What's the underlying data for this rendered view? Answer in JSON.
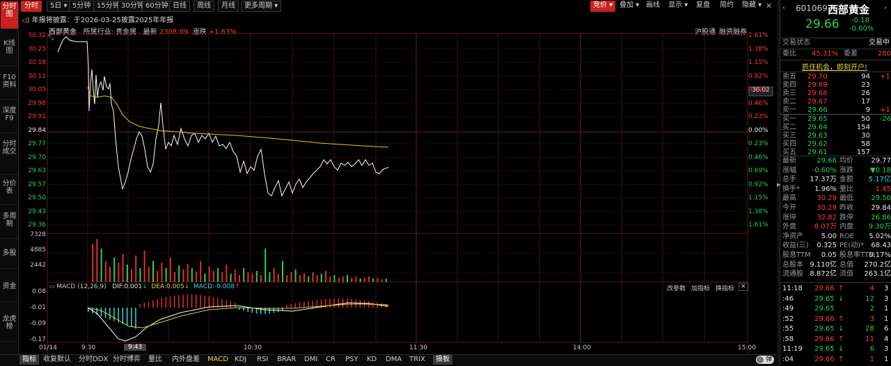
{
  "left_tabs": [
    "分时图",
    "K线图",
    "F10资料",
    "深度F9",
    "分时成交",
    "分价表",
    "多周期",
    "多股",
    "资金",
    "龙虎榜"
  ],
  "toolbar": {
    "periods": [
      "分时",
      "5日",
      "5分钟",
      "15分钟",
      "30分钟",
      "60分钟",
      "日线",
      "周线",
      "月线",
      "更多周期"
    ],
    "right": [
      "竞价",
      "叠加",
      "画线",
      "显示",
      "复盘",
      "简约",
      "隐藏"
    ]
  },
  "announcement": "年报将披露：于2026-03-25披露2025年年报",
  "info_bar": {
    "name": "西部黄金",
    "industry_label": "所属行业:",
    "industry": "贵金属",
    "latest_label": "最新",
    "latest": "2308.09",
    "change_label": "涨跌",
    "change": "+1.63%",
    "right_links": [
      "沪股通",
      "融资融券"
    ]
  },
  "price_axis_left": [
    "30.32",
    "30.25",
    "30.18",
    "30.11",
    "30.05",
    "29.98",
    "29.91",
    "29.84",
    "29.77",
    "29.70",
    "29.63",
    "29.57",
    "29.50",
    "29.43",
    "29.36"
  ],
  "price_axis_right": [
    "1.61%",
    "1.38%",
    "1.15%",
    "0.92%",
    "0.69%",
    "0.46%",
    "0.23%",
    "0.00%",
    "0.23%",
    "0.46%",
    "0.69%",
    "0.92%",
    "1.15%",
    "1.38%",
    "1.61%"
  ],
  "current_price_tag": "30.02",
  "volume_axis": [
    "7328",
    "4885",
    "2442"
  ],
  "macd": {
    "title": "MACD (12,26,9)",
    "dif": "DIF:0.001",
    "dea": "DEA:0.005",
    "macd": "MACD:-0.008",
    "axis": [
      "0.08",
      "-0.01",
      "-0.09",
      "-0.17"
    ],
    "right_links": [
      "改参数",
      "加指标",
      "换指标"
    ]
  },
  "time_axis": [
    "01/14",
    "9:30",
    "9:43",
    "10:30",
    "11:30",
    "14:00",
    "15:00"
  ],
  "bottom_tabs": [
    "指标",
    "收复默认",
    "分时DDX",
    "分时博弈",
    "量比",
    "内外盘差",
    "MACD",
    "KDJ",
    "RSI",
    "BRAR",
    "DMI",
    "CR",
    "PSY",
    "KD",
    "DMA",
    "TRIX",
    "摸板"
  ],
  "bottom_right": "弹",
  "stock": {
    "code": "601069",
    "name": "西部黄金",
    "price": "29.66",
    "change": "-0.18",
    "change_pct": "-0.60%",
    "status_label": "交易状态",
    "status": "交易中",
    "weibi_label": "委比",
    "weibi": "45.31%",
    "weicha_label": "委差",
    "weicha": "280",
    "banner": "抓住机会，即刻开户!"
  },
  "sell_orders": [
    {
      "label": "卖五",
      "price": "29.70",
      "vol": "94",
      "chg": "+1"
    },
    {
      "label": "卖四",
      "price": "29.69",
      "vol": "23",
      "chg": ""
    },
    {
      "label": "卖三",
      "price": "29.68",
      "vol": "26",
      "chg": ""
    },
    {
      "label": "卖二",
      "price": "29.67",
      "vol": "17",
      "chg": ""
    },
    {
      "label": "卖一",
      "price": "29.66",
      "vol": "9",
      "chg": "+1"
    }
  ],
  "buy_orders": [
    {
      "label": "买一",
      "price": "29.65",
      "vol": "50",
      "chg": "-26"
    },
    {
      "label": "买二",
      "price": "29.64",
      "vol": "154",
      "chg": ""
    },
    {
      "label": "买三",
      "price": "29.63",
      "vol": "30",
      "chg": ""
    },
    {
      "label": "买四",
      "price": "29.62",
      "vol": "58",
      "chg": ""
    },
    {
      "label": "买五",
      "price": "29.61",
      "vol": "157",
      "chg": ""
    }
  ],
  "quote_rows": [
    {
      "l1": "最新",
      "v1": "29.66",
      "c1": "green",
      "l2": "均价",
      "v2": "29.77",
      "c2": "white"
    },
    {
      "l1": "涨幅",
      "v1": "-0.60%",
      "c1": "green",
      "l2": "涨跌",
      "v2": "▼0.18",
      "c2": "green"
    },
    {
      "l1": "总手",
      "v1": "17.37万",
      "c1": "white",
      "l2": "金额",
      "v2": "5.17亿",
      "c2": "cyan"
    },
    {
      "l1": "换手*",
      "v1": "1.96%",
      "c1": "white",
      "l2": "量比",
      "v2": "1.45",
      "c2": "red"
    },
    {
      "l1": "最高",
      "v1": "30.29",
      "c1": "red",
      "l2": "最低",
      "v2": "29.50",
      "c2": "green"
    },
    {
      "l1": "今开",
      "v1": "30.29",
      "c1": "red",
      "l2": "昨收",
      "v2": "29.84",
      "c2": "white"
    },
    {
      "l1": "涨停",
      "v1": "32.82",
      "c1": "red",
      "l2": "跌停",
      "v2": "26.86",
      "c2": "green"
    },
    {
      "l1": "外盘",
      "v1": "8.07万",
      "c1": "red",
      "l2": "内盘",
      "v2": "9.30万",
      "c2": "green"
    },
    {
      "l1": "净资产",
      "v1": "5.00",
      "c1": "white",
      "l2": "ROE",
      "v2": "5.02%",
      "c2": "white"
    },
    {
      "l1": "收益(三)",
      "v1": "0.325",
      "c1": "white",
      "l2": "PE(动)*",
      "v2": "68.43",
      "c2": "white"
    },
    {
      "l1": "股息TTM",
      "v1": "0.05",
      "c1": "white",
      "l2": "股息率TTM",
      "v2": "0.17%",
      "c2": "white"
    },
    {
      "l1": "总股本",
      "v1": "9.110亿",
      "c1": "white",
      "l2": "总值",
      "v2": "270.2亿",
      "c2": "white"
    },
    {
      "l1": "流通股",
      "v1": "8.872亿",
      "c1": "white",
      "l2": "流值",
      "v2": "263.1亿",
      "c2": "white"
    }
  ],
  "ticks": [
    {
      "time": "11:18",
      "price": "29.66",
      "dir": "↑",
      "vol": "4",
      "n": "3",
      "pc": "red"
    },
    {
      "time": ":46",
      "price": "29.65",
      "dir": "↓",
      "vol": "12",
      "n": "3",
      "pc": "green"
    },
    {
      "time": ":49",
      "price": "29.65",
      "dir": "",
      "vol": "2",
      "n": "1",
      "pc": "green"
    },
    {
      "time": ":52",
      "price": "29.66",
      "dir": "↑",
      "vol": "3",
      "n": "1",
      "pc": "red"
    },
    {
      "time": ":55",
      "price": "29.65",
      "dir": "↓",
      "vol": "28",
      "n": "6",
      "pc": "green"
    },
    {
      "time": ":58",
      "price": "29.66",
      "dir": "↑",
      "vol": "11",
      "n": "4",
      "pc": "red"
    },
    {
      "time": "11:19",
      "price": "29.65",
      "dir": "↓",
      "vol": "6",
      "n": "3",
      "pc": "green"
    },
    {
      "time": ":04",
      "price": "29.66",
      "dir": "↑",
      "vol": "1",
      "n": "1",
      "pc": "red"
    }
  ]
}
